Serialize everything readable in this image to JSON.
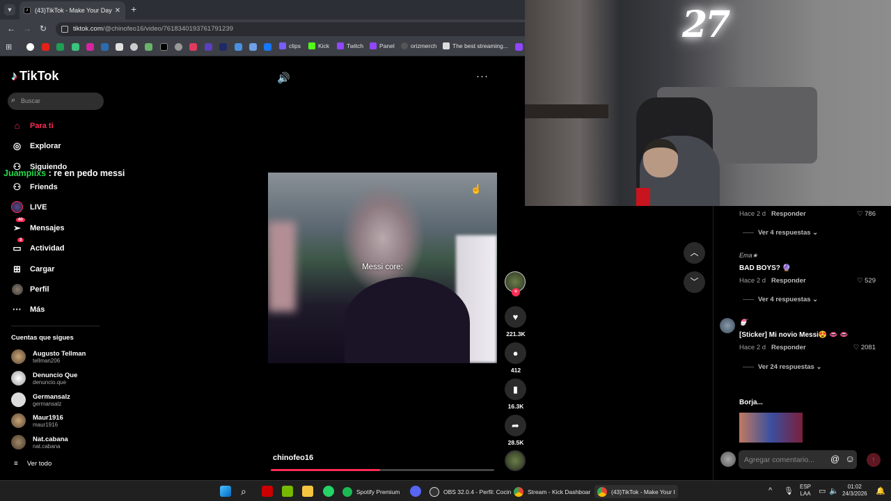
{
  "browser": {
    "tab_title": "(43)TikTok - Make Your Day",
    "url_domain": "tiktok.com",
    "url_path": "/@chinofeo16/video/7618340193761791239",
    "bookmarks": [
      "clips",
      "Kick",
      "Twitch",
      "Panel",
      "orizmerch",
      "The best streaming..."
    ]
  },
  "sidebar": {
    "logo": "TikTok",
    "search_placeholder": "Buscar",
    "nav": [
      {
        "label": "Para ti",
        "icon": "home-icon"
      },
      {
        "label": "Explorar",
        "icon": "compass-icon"
      },
      {
        "label": "Siguiendo",
        "icon": "following-icon"
      },
      {
        "label": "Friends",
        "icon": "friends-icon"
      },
      {
        "label": "LIVE",
        "icon": "live-icon"
      },
      {
        "label": "Mensajes",
        "icon": "messages-icon",
        "badge": "40"
      },
      {
        "label": "Actividad",
        "icon": "activity-icon",
        "badge": "3"
      },
      {
        "label": "Cargar",
        "icon": "upload-icon"
      },
      {
        "label": "Perfil",
        "icon": "profile-icon"
      },
      {
        "label": "Más",
        "icon": "more-icon"
      }
    ],
    "following_header": "Cuentas que sigues",
    "following": [
      {
        "name": "Augusto Tellman",
        "handle": "tellman206"
      },
      {
        "name": "Denuncio Que",
        "handle": "denuncio.que"
      },
      {
        "name": "Germansalz",
        "handle": "germansalz"
      },
      {
        "name": "Maur1916",
        "handle": "maur1916"
      },
      {
        "name": "Nat.cabana",
        "handle": "nat.cabana"
      }
    ],
    "see_all": "Ver todo"
  },
  "chat_overlay": {
    "user": "Juampiixs",
    "message": " : re en pedo messi"
  },
  "video": {
    "caption": "Messi core:",
    "author": "chinofeo16",
    "progress": 0.49
  },
  "actions": {
    "likes": "221.3K",
    "comments": "412",
    "saves": "16.3K",
    "shares": "28.5K"
  },
  "webcam": {
    "neon_sign": "27"
  },
  "comments_panel": {
    "items": [
      {
        "time": "Hace 2 d",
        "reply_label": "Responder",
        "likes": "786",
        "replies": "Ver 4 respuestas"
      },
      {
        "user": "Ema★",
        "text": "BAD BOYS? 🔮",
        "time": "Hace 2 d",
        "reply_label": "Responder",
        "likes": "529",
        "replies": "Ver 4 respuestas"
      },
      {
        "user": "🍧",
        "text": "[Sticker] Mi novio Messi😍 👄 👄",
        "time": "Hace 2 d",
        "reply_label": "Responder",
        "likes": "2081",
        "replies": "Ver 24 respuestas"
      },
      {
        "user": "Borja..."
      }
    ],
    "input_placeholder": "Agregar comentario..."
  },
  "taskbar": {
    "apps": [
      "Spotify Premium",
      "OBS 32.0.4 - Perfil: Cocin",
      "Stream - Kick Dashboar",
      "(43)TikTok - Make Your I"
    ],
    "lang": "ESP",
    "lang2": "LAA",
    "time": "01:02",
    "date": "24/3/2026"
  }
}
